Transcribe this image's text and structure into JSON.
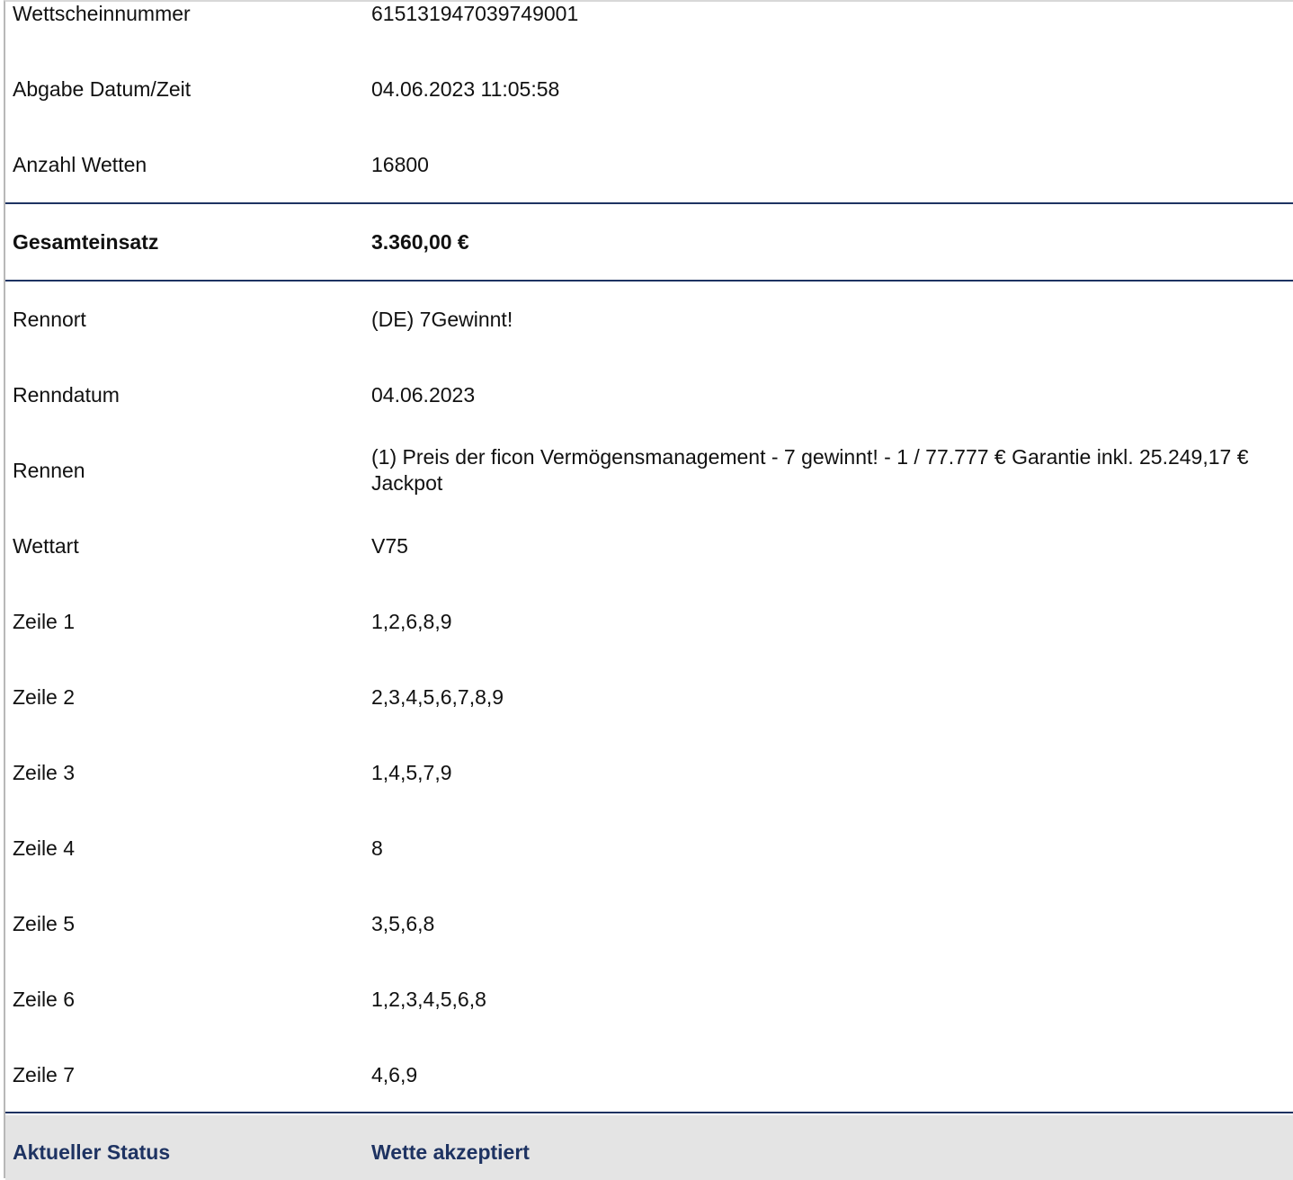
{
  "bet_details": {
    "slip_number": {
      "label": "Wettscheinnummer",
      "value": "615131947039749001"
    },
    "submitted_at": {
      "label": "Abgabe Datum/Zeit",
      "value": "04.06.2023 11:05:58"
    },
    "bet_count": {
      "label": "Anzahl Wetten",
      "value": "16800"
    },
    "total_stake": {
      "label": "Gesamteinsatz",
      "value": "3.360,00 €"
    },
    "venue": {
      "label": "Rennort",
      "value": "(DE) 7Gewinnt!"
    },
    "race_date": {
      "label": "Renndatum",
      "value": "04.06.2023"
    },
    "race": {
      "label": "Rennen",
      "value": "(1) Preis der ficon Vermögensmanagement - 7 gewinnt! - 1 / 77.777 € Garantie inkl. 25.249,17 € Jackpot"
    },
    "bet_type": {
      "label": "Wettart",
      "value": "V75"
    },
    "lines": [
      {
        "label": "Zeile 1",
        "value": "1,2,6,8,9"
      },
      {
        "label": "Zeile 2",
        "value": "2,3,4,5,6,7,8,9"
      },
      {
        "label": "Zeile 3",
        "value": "1,4,5,7,9"
      },
      {
        "label": "Zeile 4",
        "value": "8"
      },
      {
        "label": "Zeile 5",
        "value": "3,5,6,8"
      },
      {
        "label": "Zeile 6",
        "value": "1,2,3,4,5,6,8"
      },
      {
        "label": "Zeile 7",
        "value": "4,6,9"
      }
    ],
    "status": {
      "label": "Aktueller Status",
      "value": "Wette akzeptiert"
    }
  },
  "colors": {
    "rule": "#1e3362",
    "status_text": "#1e3362",
    "status_background": "#e4e4e4"
  }
}
